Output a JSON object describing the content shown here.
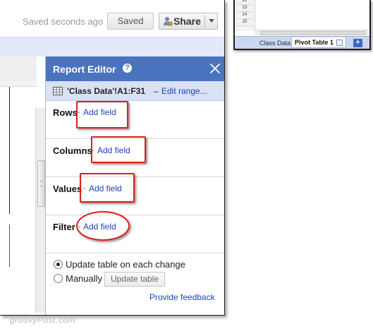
{
  "topbar": {
    "saved_status": "Saved seconds ago",
    "saved_button": "Saved",
    "share_button": "Share"
  },
  "report_editor": {
    "title": "Report Editor",
    "help_glyph": "?",
    "range_label": "'Class Data'!A1:F31",
    "range_dash": "–",
    "edit_range": "Edit range...",
    "sections": [
      {
        "label": "Rows",
        "dash": "-",
        "link": "Add field"
      },
      {
        "label": "Columns",
        "dash": "-",
        "link": "Add field"
      },
      {
        "label": "Values",
        "dash": "-",
        "link": "Add field"
      },
      {
        "label": "Filter",
        "dash": "-",
        "link": "Add field"
      }
    ],
    "options": {
      "update_each_change": "Update table on each change",
      "manually": "Manually",
      "update_button": "Update table",
      "selected": "update_each_change"
    },
    "feedback": "Provide feedback"
  },
  "inset": {
    "row_numbers": [
      "22",
      "23",
      "24",
      "25"
    ],
    "tabs": [
      "Class Data",
      "Pivot Table 1"
    ],
    "active_tab": "Pivot Table 1",
    "add_sheet": "+"
  },
  "watermark": "groovyPost.com",
  "colors": {
    "editor_header": "#4a74bd",
    "range_bar": "#d9e1f4",
    "link": "#1f43b8",
    "highlight": "#e01c1c"
  }
}
